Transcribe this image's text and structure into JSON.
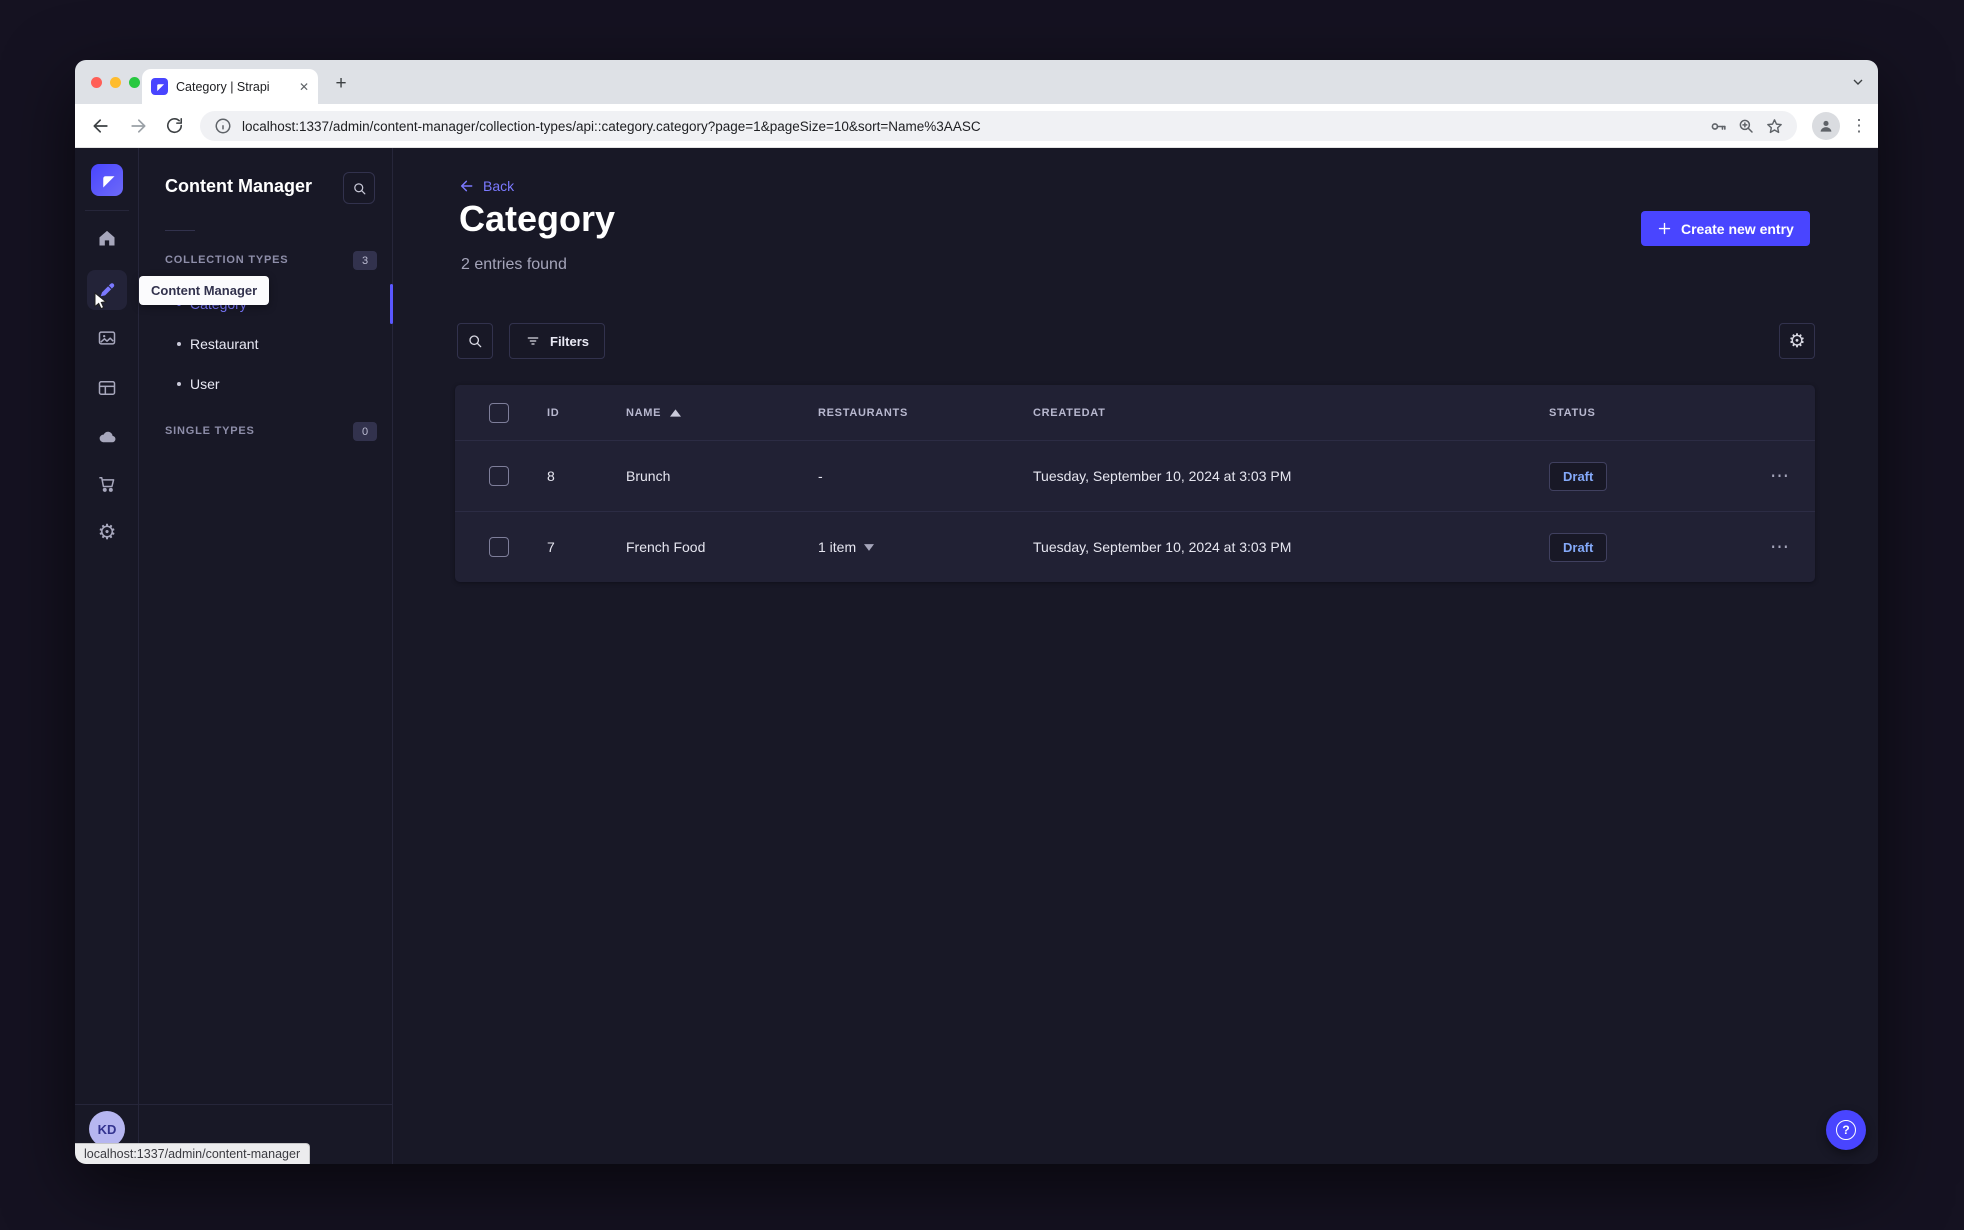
{
  "browser": {
    "tab": {
      "title": "Category | Strapi"
    },
    "url": "localhost:1337/admin/content-manager/collection-types/api::category.category?page=1&pageSize=10&sort=Name%3AASC",
    "status_bubble": "localhost:1337/admin/content-manager"
  },
  "icons": {
    "close": "✕",
    "plus": "+",
    "dots_vertical": "⋮",
    "dots_horizontal": "⋯",
    "gear": "⚙",
    "question": "?"
  },
  "app": {
    "nav": {
      "tooltip": "Content Manager",
      "user_initials": "KD"
    },
    "subnav": {
      "title": "Content Manager",
      "collection_types": {
        "label": "COLLECTION TYPES",
        "count": "3"
      },
      "items": [
        {
          "label": "Category",
          "active": true
        },
        {
          "label": "Restaurant",
          "active": false
        },
        {
          "label": "User",
          "active": false
        }
      ],
      "single_types": {
        "label": "SINGLE TYPES",
        "count": "0"
      }
    },
    "header": {
      "back_label": "Back",
      "title": "Category",
      "subtitle": "2 entries found",
      "create_label": "Create new entry"
    },
    "toolbar": {
      "filters_label": "Filters"
    },
    "table": {
      "columns": {
        "id": "ID",
        "name": "NAME",
        "restaurants": "RESTAURANTS",
        "createdat": "CREATEDAT",
        "status": "STATUS"
      },
      "sorted_by": "NAME",
      "sort_direction": "ASC",
      "rows": [
        {
          "id": "8",
          "name": "Brunch",
          "restaurants": "-",
          "has_relation_toggle": false,
          "createdat": "Tuesday, September 10, 2024 at 3:03 PM",
          "status": "Draft"
        },
        {
          "id": "7",
          "name": "French Food",
          "restaurants": "1 item",
          "has_relation_toggle": true,
          "createdat": "Tuesday, September 10, 2024 at 3:03 PM",
          "status": "Draft"
        }
      ]
    },
    "colors": {
      "brand": "#4945ff",
      "brand_light": "#7b79ff",
      "draft_text": "#84a9f9",
      "card_bg": "#212134",
      "page_bg": "#181826"
    }
  }
}
